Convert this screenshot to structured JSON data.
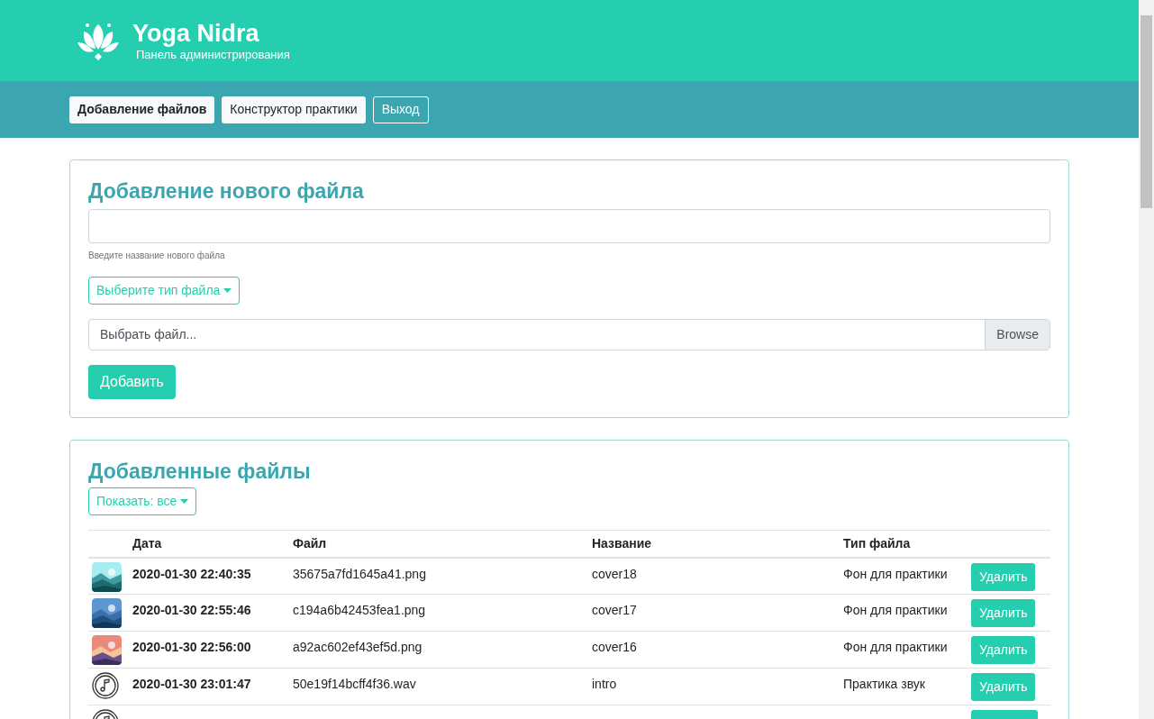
{
  "header": {
    "title": "Yoga Nidra",
    "subtitle": "Панель администрирования"
  },
  "nav": [
    {
      "label": "Добавление файлов",
      "selected": true,
      "kind": "light"
    },
    {
      "label": "Конструктор практики",
      "selected": false,
      "kind": "light"
    },
    {
      "label": "Выход",
      "selected": false,
      "kind": "outline"
    }
  ],
  "upload": {
    "heading": "Добавление нового файла",
    "name_help": "Введите название нового файла",
    "type_dropdown": "Выберите тип файла",
    "file_placeholder": "Выбрать файл...",
    "browse": "Browse",
    "submit": "Добавить"
  },
  "files": {
    "heading": "Добавленные файлы",
    "filter": "Показать: все",
    "columns": [
      "Дата",
      "Файл",
      "Название",
      "Тип файла"
    ],
    "rows": [
      {
        "date": "2020-01-30 22:40:35",
        "file": "35675a7fd1645a41.png",
        "name": "cover18",
        "type": "Фон для практики",
        "action": "Удалить"
      },
      {
        "date": "2020-01-30 22:55:46",
        "file": "c194a6b42453fea1.png",
        "name": "cover17",
        "type": "Фон для практики",
        "action": "Удалить"
      },
      {
        "date": "2020-01-30 22:56:00",
        "file": "a92ac602ef43ef5d.png",
        "name": "cover16",
        "type": "Фон для практики",
        "action": "Удалить"
      },
      {
        "kind": "audio",
        "date": "2020-01-30 23:01:47",
        "file": "50e19f14bcff4f36.wav",
        "name": "intro",
        "type": "Практика звук",
        "action": "Удалить"
      },
      {
        "kind": "audio"
      }
    ]
  }
}
